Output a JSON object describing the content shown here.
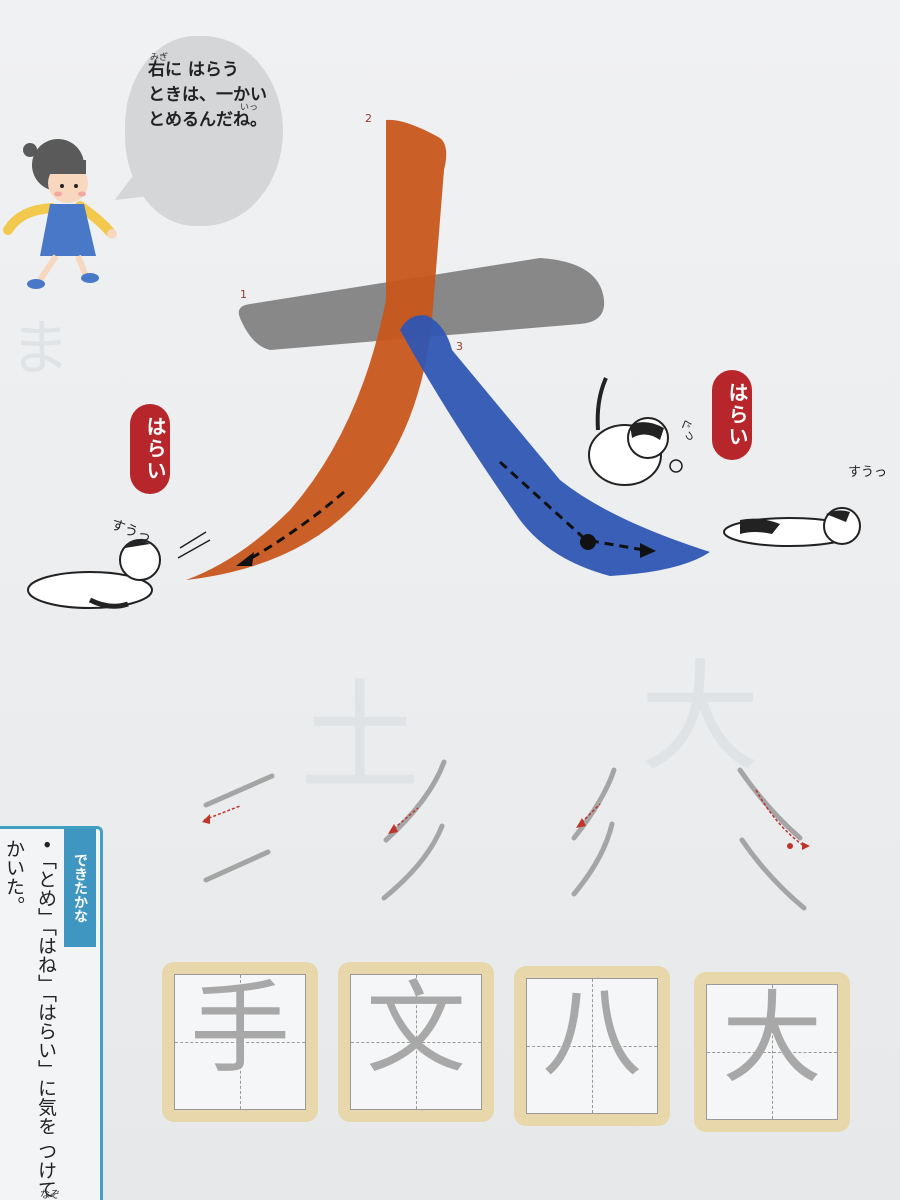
{
  "speech_bubble": {
    "lines": [
      "右に はらう",
      "ときは、一かい",
      "とめるんだね。"
    ],
    "ruby_migi": "みぎ",
    "ruby_ikkai": "いっ"
  },
  "main_character": {
    "kanji": "大",
    "stroke_numbers": [
      "1",
      "2",
      "3"
    ],
    "stroke_colors": {
      "stroke1": "#7f7f7f",
      "stroke2": "#c8561c",
      "stroke3": "#2f56b3"
    }
  },
  "labels": {
    "harai_left": "はらい",
    "harai_right": "はらい",
    "cat_sound_left": "すうっ",
    "cat_sound_right": "すうっ",
    "cat_sound_gu": "ぐっ"
  },
  "check_panel": {
    "title": "できたかな",
    "text": "•「とめ」「はね」「はらい」に気を つけて かいた。"
  },
  "practice_characters": [
    "手",
    "文",
    "八",
    "大"
  ],
  "bottom_fragment": "なぞ",
  "colors": {
    "accent_red": "#b7262a",
    "check_blue": "#3f96c0",
    "grid_frame": "#e8d7ab"
  }
}
